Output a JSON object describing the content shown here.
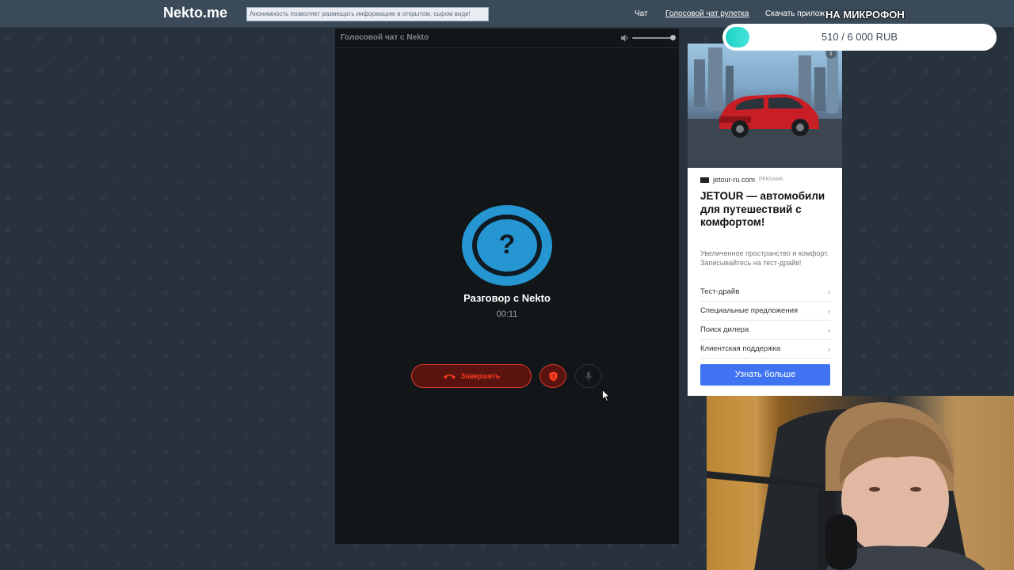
{
  "topbar": {
    "logo": "Nekto.me",
    "slogan": "Анонимность позволяет размещать информацию в открытом, сыром виде!",
    "links": {
      "chat": "Чат",
      "voice_chat": "Голосовой чат рулетка",
      "download": "Скачать прилож"
    }
  },
  "donation": {
    "title": "НА МИКРОФОН",
    "text": "510 / 6 000 RUB",
    "raised": 510,
    "goal": 6000,
    "colors": {
      "fill": "#1fd3c6",
      "track": "#ffffff"
    }
  },
  "chat_panel": {
    "title": "Голосовой чат с Nekto",
    "volume_level": 1.0,
    "avatar_symbol": "?",
    "partner_label": "Разговор с Nekto",
    "timer": "00:11",
    "end_call_label": "Завершить",
    "icons": [
      "volume-icon",
      "phone-hangup-icon",
      "shield-icon",
      "microphone-icon"
    ],
    "colors": {
      "accent": "#2596d1",
      "danger": "#d93a2b"
    }
  },
  "ad": {
    "domain": "jetour-ru.com",
    "badge": "РЕКЛАМА",
    "headline": "JETOUR — автомобили для путешествий с комфортом!",
    "description": "Увеличенное пространство и комфорт. Записывайтесь на тест-драйв!",
    "links": [
      "Тест-драйв",
      "Специальные предложения",
      "Поиск дилера",
      "Клиентская поддержка"
    ],
    "cta": "Узнать больше",
    "info_symbol": "i",
    "colors": {
      "cta": "#3f73f1"
    }
  }
}
